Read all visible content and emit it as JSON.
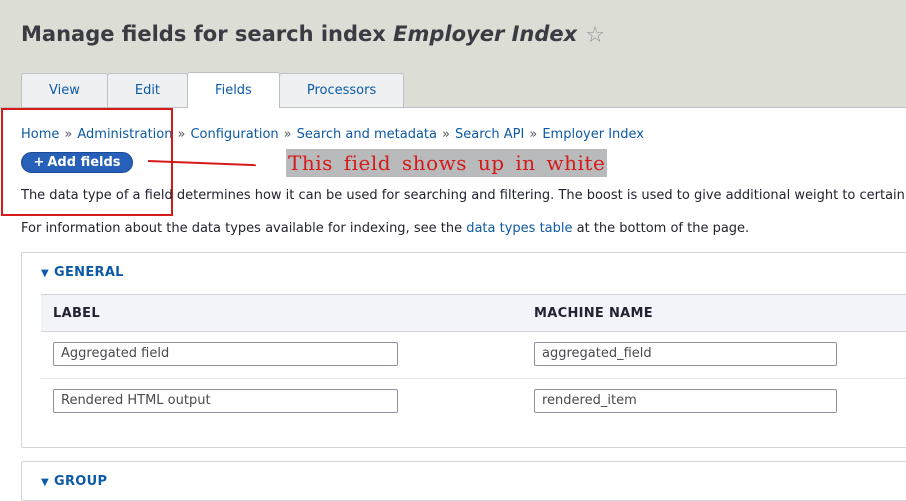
{
  "header": {
    "title_prefix": "Manage fields for search index ",
    "title_index": "Employer Index",
    "star_icon": "star-outline-icon",
    "tabs": [
      {
        "label": "View",
        "active": false
      },
      {
        "label": "Edit",
        "active": false
      },
      {
        "label": "Fields",
        "active": true
      },
      {
        "label": "Processors",
        "active": false
      }
    ]
  },
  "breadcrumb": {
    "separator": "»",
    "items": [
      "Home",
      "Administration",
      "Configuration",
      "Search and metadata",
      "Search API",
      "Employer Index"
    ]
  },
  "actions": {
    "add_fields_label": "Add fields",
    "add_fields_icon": "plus-icon"
  },
  "annotation": {
    "text": "This field shows up in white",
    "color": "#d51a1a"
  },
  "description": {
    "line1": "The data type of a field determines how it can be used for searching and filtering. The boost is used to give additional weight to certain",
    "line2_before": "For information about the data types available for indexing, see the ",
    "line2_link": "data types table",
    "line2_after": " at the bottom of the page."
  },
  "groups": [
    {
      "legend": "GENERAL",
      "expanded": true,
      "columns": [
        "LABEL",
        "MACHINE NAME"
      ],
      "rows": [
        {
          "label": "Aggregated field",
          "machine_name": "aggregated_field"
        },
        {
          "label": "Rendered HTML output",
          "machine_name": "rendered_item"
        }
      ]
    },
    {
      "legend": "GROUP",
      "expanded": true
    }
  ],
  "colors": {
    "header_bg": "#dcddd4",
    "link": "#0d5aa6",
    "primary_button": "#2660b8"
  }
}
